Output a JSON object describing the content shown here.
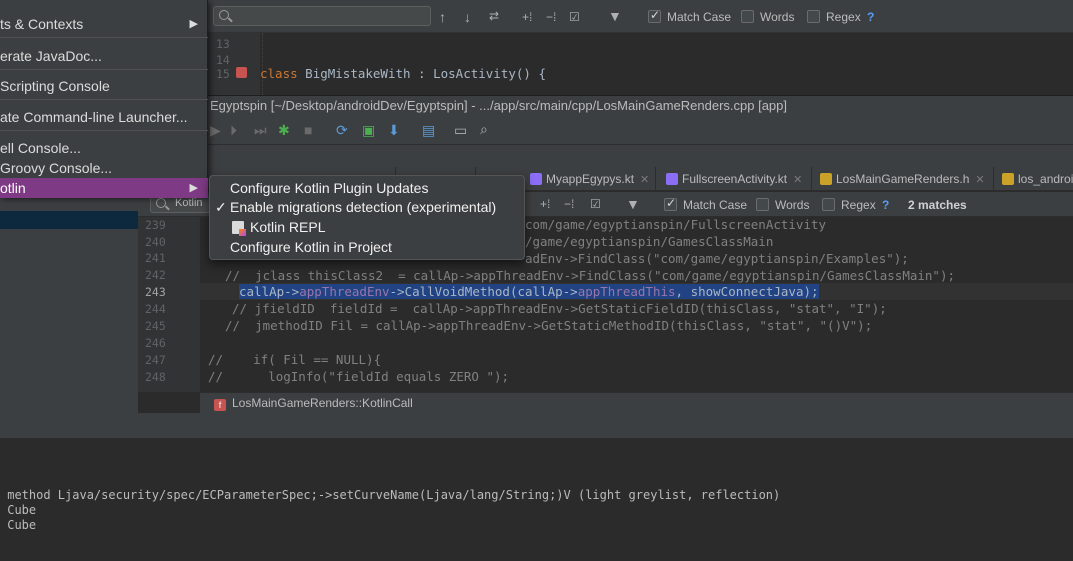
{
  "menu": {
    "items": [
      {
        "label": "ts & Contexts",
        "arrow": "▶"
      },
      {
        "label": "erate JavaDoc..."
      },
      {
        "label": " Scripting Console"
      },
      {
        "label": "ate Command-line Launcher..."
      },
      {
        "label": "ell Console..."
      },
      {
        "label": "Groovy Console..."
      },
      {
        "label": "otlin",
        "arrow": "▶"
      }
    ]
  },
  "submenu": {
    "items": [
      {
        "label": "Configure Kotlin Plugin Updates",
        "check": ""
      },
      {
        "label": "Enable migrations detection (experimental)",
        "check": "✓"
      },
      {
        "label": "Kotlin REPL",
        "check": "",
        "icon": "kotlin-repl-icon"
      },
      {
        "label": "Configure Kotlin in Project",
        "check": ""
      }
    ]
  },
  "top_find": {
    "match_case": "Match Case",
    "words": "Words",
    "regex": "Regex",
    "help": "?"
  },
  "back_editor": {
    "lines": [
      "13",
      "14",
      "15"
    ],
    "code_keyword": "class",
    "code_rest": " BigMistakeWith : LosActivity() {"
  },
  "window": {
    "title": "Egyptspin [~/Desktop/androidDev/Egyptspin] - .../app/src/main/cpp/LosMainGameRenders.cpp [app]"
  },
  "tabs": [
    {
      "label": "MyappEgypys.kt",
      "color": "#8b6ef5"
    },
    {
      "label": "FullscreenActivity.kt",
      "color": "#8b6ef5"
    },
    {
      "label": "LosMainGameRenders.h",
      "color": "#c9a227"
    },
    {
      "label": "los_androi",
      "color": "#c9a227"
    }
  ],
  "find2": {
    "search_value": "Kotlin",
    "match_case": "Match Case",
    "words": "Words",
    "regex": "Regex",
    "help": "?",
    "matches": "2 matches"
  },
  "code": {
    "line_numbers": [
      "239",
      "240",
      "241",
      "242",
      "243",
      "244",
      "245",
      "246",
      "247",
      "248"
    ],
    "current_line": "243",
    "line239": "com/game/egyptianspin/FullscreenActivity",
    "line240": "/game/egyptianspin/GamesClassMain",
    "line241a": "adEnv->FindClass(",
    "line241b": "\"com/game/egyptianspin/Examples\"",
    "line241c": ");",
    "line242a": "//  jclass thisClass2  = callAp->appThreadEnv->FindClass(",
    "line242b": "\"com/game/egyptianspin/GamesClassMain\"",
    "line242c": ");",
    "line243a": "callAp->",
    "line243b": "appThreadEnv",
    "line243c": "->CallVoidMethod(callAp->",
    "line243d": "appThreadThis",
    "line243e": ", showConnectJava);",
    "line244a": "// jfieldID  fieldId =  callAp->appThreadEnv->GetStaticFieldID(thisClass, ",
    "line244b": "\"stat\", \"I\"",
    "line244c": ");",
    "line245a": "//  jmethodID Fil = callAp->appThreadEnv->GetStaticMethodID(thisClass, ",
    "line245b": "\"stat\", \"()V\"",
    "line245c": ");",
    "line247": "//    if( Fil == NULL){",
    "line248a": "//      logInfo(",
    "line248b": "\"fieldId equals ZERO \"",
    "line248c": ");"
  },
  "breadcrumb": {
    "badge": "f",
    "text": "LosMainGameRenders::KotlinCall"
  },
  "console": {
    "line1": " method Ljava/security/spec/ECParameterSpec;->setCurveName(Ljava/lang/String;)V (light greylist, reflection)",
    "line2": " Cube",
    "line3": " Cube"
  },
  "colors": {
    "menu_selection": "#7e3a84",
    "text_selection": "#214283",
    "accent_blue": "#589df6"
  }
}
